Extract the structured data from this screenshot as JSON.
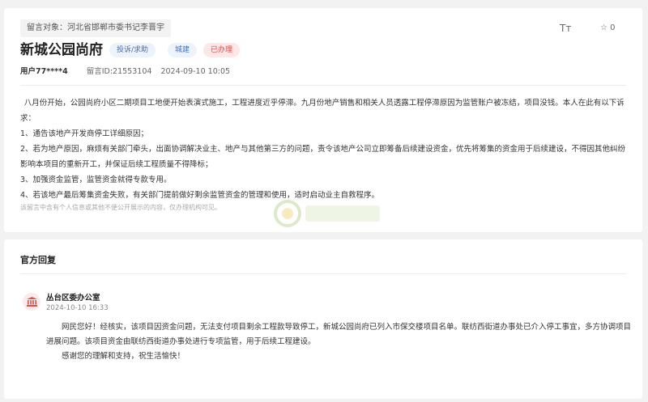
{
  "message": {
    "target_label": "留言对象：河北省邯郸市委书记李晋宇",
    "title": "新城公园尚府",
    "tags": [
      "投诉/求助",
      "城建",
      "已办理"
    ],
    "font_tool": "Tт",
    "favorite_count": "0",
    "user": "用户77****4",
    "message_id": "留言ID:21553104",
    "datetime": "2024-09-10 10:05",
    "content": [
      "八月份开始，公园尚府小区二期项目工地便开始表演式施工，工程进度近乎停滞。九月份地产销售和相关人员透露工程停滞原因为监管账户被冻结，项目没钱。本人在此有以下诉求：",
      "1、通告该地产开发商停工详细原因；",
      "2、若为地产原因，麻烦有关部门牵头，出面协调解决业主、地产与其他第三方的问题，责令该地产公司立即筹备后续建设资金，优先将筹集的资金用于后续建设，不得因其他纠纷影响本项目的重新开工，并保证后续工程质量不得降标；",
      "3、加强资金监管，监管资金就得专款专用。",
      "4、若该地产最后筹集资金失败，有关部门提前做好剩余监管资金的管理和使用，适时启动业主自救程序。"
    ],
    "privacy_notice": "该留言中含有个人信息或其他不便公开展示的内容，仅办理机构可见。"
  },
  "reply": {
    "heading": "官方回复",
    "org": "丛台区委办公室",
    "time": "2024-10-10 16:33",
    "paragraphs": [
      "网民您好！经核实，该项目因资金问题，无法支付项目剩余工程款导致停工，新城公园尚府已列入市保交楼项目名单。联纺西街道办事处已介入停工事宜，多方协调项目进展问题。该项目资金由联纺西街道办事处进行专项监管，用于后续工程建设。",
      "感谢您的理解和支持，祝生活愉快！"
    ]
  },
  "colors": {
    "status_red": "#e04848",
    "tag_blue": "#3a76c2",
    "org_icon": "#d9534f"
  }
}
